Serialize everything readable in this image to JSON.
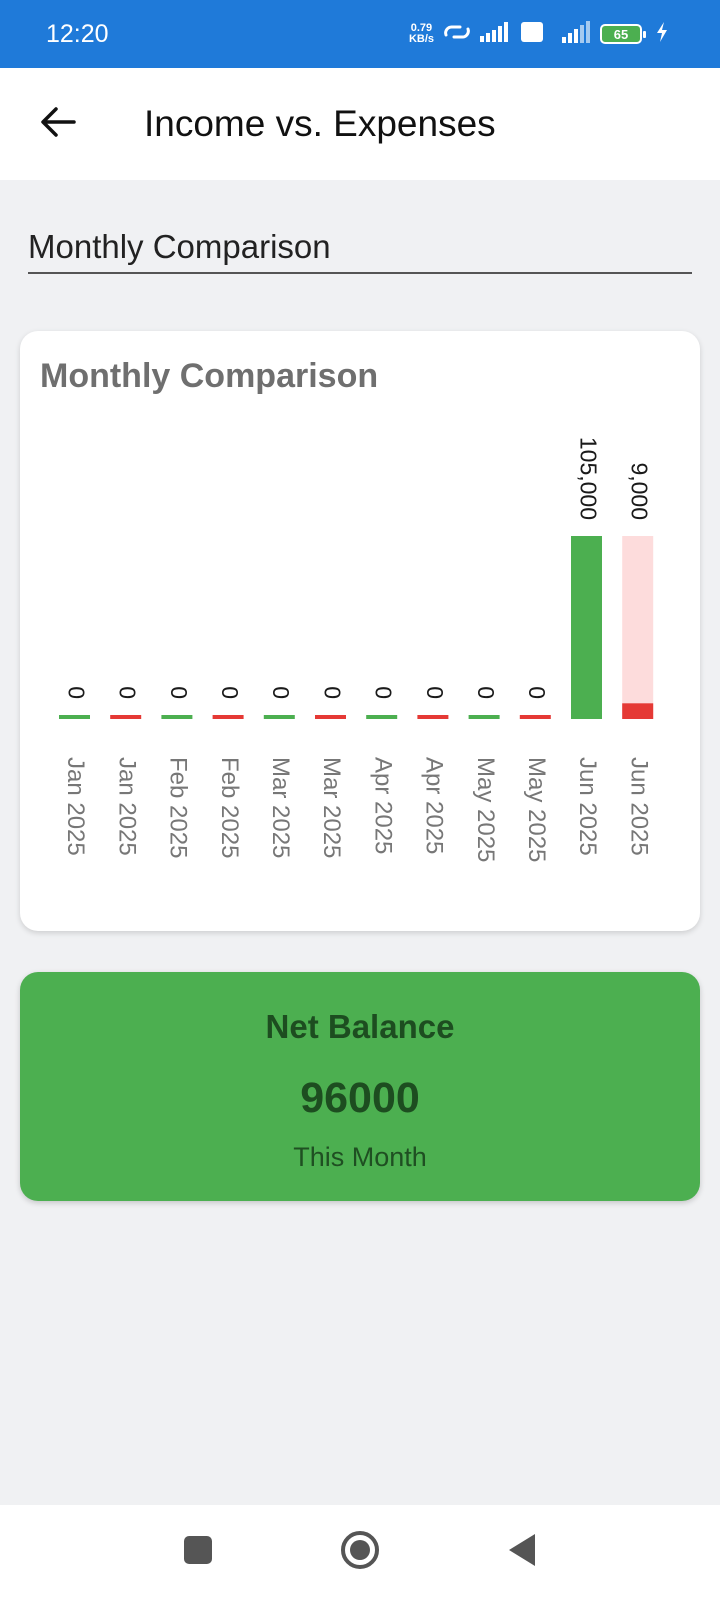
{
  "status_bar": {
    "time": "12:20",
    "net_speed_value": "0.79",
    "net_speed_unit": "KB/s",
    "network_type": "4G",
    "volte_label": "Vo LTE",
    "battery_level": "65"
  },
  "app_bar": {
    "title": "Income vs. Expenses"
  },
  "dropdown": {
    "selected": "Monthly Comparison"
  },
  "chart_card": {
    "title": "Monthly Comparison"
  },
  "colors": {
    "income": "#4caf50",
    "expense": "#e53935",
    "expense_bg": "#fddcdc",
    "accent": "#1f7ad9"
  },
  "chart_data": {
    "type": "bar",
    "title": "Monthly Comparison",
    "categories": [
      "Jan 2025",
      "Jan 2025",
      "Feb 2025",
      "Feb 2025",
      "Mar 2025",
      "Mar 2025",
      "Apr 2025",
      "Apr 2025",
      "May 2025",
      "May 2025",
      "Jun 2025",
      "Jun 2025"
    ],
    "values": [
      0,
      0,
      0,
      0,
      0,
      0,
      0,
      0,
      0,
      0,
      105000,
      9000
    ],
    "value_labels": [
      "0",
      "0",
      "0",
      "0",
      "0",
      "0",
      "0",
      "0",
      "0",
      "0",
      "105,000",
      "9,000"
    ],
    "kinds": [
      "income",
      "expense",
      "income",
      "expense",
      "income",
      "expense",
      "income",
      "expense",
      "income",
      "expense",
      "income",
      "expense"
    ],
    "ylim": [
      0,
      105000
    ],
    "grid": false,
    "legend": "none"
  },
  "net_balance": {
    "title": "Net Balance",
    "value": "96000",
    "subtitle": "This Month"
  },
  "nav_bar": {
    "recents_icon": "square-icon",
    "home_icon": "circle-icon",
    "back_icon": "triangle-back-icon"
  }
}
